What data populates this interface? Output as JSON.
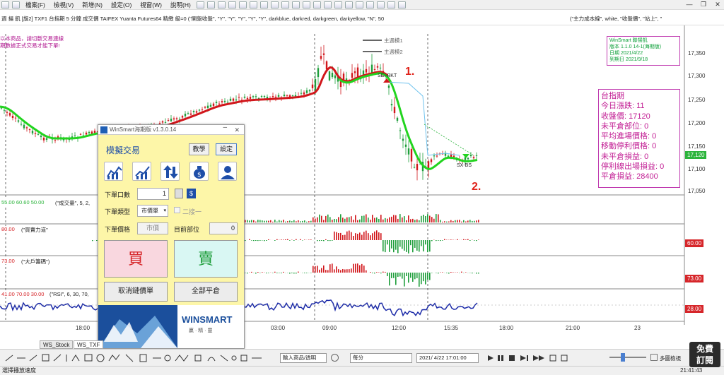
{
  "menu": {
    "items": [
      "檔案(F)",
      "檢視(V)",
      "新增(N)",
      "設定(O)",
      "視窗(W)",
      "說明(H)"
    ],
    "window_controls": [
      "—",
      "❐",
      "✕"
    ]
  },
  "infobar": {
    "text": "週 揚 凱 [旗2] TXF1 台指期 5 分鐘 成交價 TAIFEX Yuanta Futures64 精緻 級=0 (\"開盤收盤\", \"Y\", \"Y\", \"Y\", \"Y\", \"Y\", darkblue, darkred, darkgreen, darkyellow, \"N\", 50",
    "right_text": "(\"主力成本線\", white, \"收盤價\", \"站上\", \""
  },
  "note": {
    "lines": [
      "以本商品，請切斷交易連線",
      "期數據正式交易才能下單!"
    ]
  },
  "legend": {
    "line1": "主週模1",
    "line2": "主週模2"
  },
  "winsmart_box": {
    "lines": [
      "WinSmart 聯揚凱",
      "版本 1.1.0 14-1(海期版)",
      "日期 2021/4/22",
      "到期日 2021/9/18"
    ]
  },
  "stats": {
    "title": "台指期",
    "lines": [
      "今日漲跌: 11",
      "收盤價: 17120",
      "未平倉部位: 0",
      "平均進場價格: 0",
      "移動停利價格: 0",
      "未平倉損益: 0",
      "停利線出場損益: 0",
      "平倉損益: 28400"
    ]
  },
  "price_axis": {
    "ticks": [
      "17,350",
      "17,300",
      "17,250",
      "17,200",
      "17,150",
      "17,100",
      "17,050"
    ],
    "current": "17,120"
  },
  "signals": {
    "buy": "SEI-BKT",
    "sell": "SX-BS"
  },
  "annotations": {
    "one": "1.",
    "two": "2."
  },
  "indicators": {
    "volume": "(\"成交量\", 5, 2,",
    "volume_vals": "55.00 60.60 50.00",
    "power": "(\"買賣力道\"",
    "power_val": "80.00",
    "power_badge": "60.00",
    "big": "(\"大戶籌碼\")",
    "big_val": "73.00",
    "big_badge": "73.00",
    "rsi": "(\"RSI\", 6, 30, 70,",
    "rsi_vals": "41.00 70.00 30.00",
    "rsi_badge": "28.00"
  },
  "time_axis": {
    "ticks": [
      "18:00",
      "03:00",
      "09:00",
      "12:00",
      "15:35",
      "18:00",
      "21:00",
      "23"
    ]
  },
  "sim": {
    "title": "WinSmart海期版 v1.3.0.14",
    "heading": "模擬交易",
    "btn_teach": "教學",
    "btn_settings": "設定",
    "qty_label": "下單口數",
    "qty_value": "1",
    "type_label": "下單類型",
    "type_value": "市價單",
    "second_label": "二接一",
    "price_label": "下單價格",
    "price_value": "市價",
    "pos_label": "目前部位",
    "pos_value": "0",
    "buy_label": "買",
    "sell_label": "賣",
    "cancel_label": "取消鏈價單",
    "close_all_label": "全部平倉",
    "logo": "WINSMART",
    "logo_sub": "贏 · 精 · 靈"
  },
  "tabs": [
    "WS_Stock",
    "WS_TXF"
  ],
  "bottom": {
    "product_dd": "輸入商品/透明",
    "period_dd": "每分",
    "datetime_dd": "2021/ 4/22 17:01:00",
    "zoom_label": "多圖檢視"
  },
  "status": {
    "left": "選擇播放速度",
    "right": "21:41:43"
  },
  "subscribe": {
    "line1": "免費",
    "line2": "訂閱"
  },
  "colors": {
    "green_line": "#22d41f",
    "red_line": "#d1161b",
    "blue_rsi": "#1b2aa8",
    "magenta": "#c21f94",
    "badge_green": "#2bb43b",
    "badge_red": "#d6262a"
  }
}
